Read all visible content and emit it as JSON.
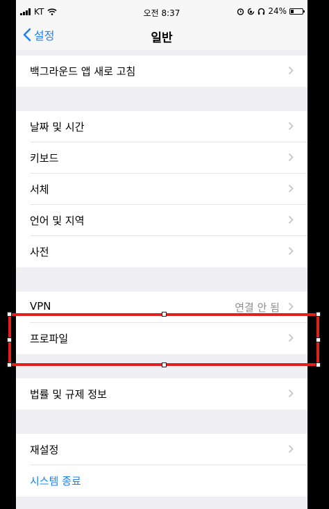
{
  "status_bar": {
    "carrier": "KT",
    "time": "오전 8:37",
    "battery": "24%",
    "battery_level": 0.24
  },
  "nav": {
    "back_label": "설정",
    "title": "일반"
  },
  "groups": [
    {
      "items": [
        {
          "label": "백그라운드 앱 새로 고침"
        }
      ]
    },
    {
      "items": [
        {
          "label": "날짜 및 시간"
        },
        {
          "label": "키보드"
        },
        {
          "label": "서체"
        },
        {
          "label": "언어 및 지역"
        },
        {
          "label": "사전"
        }
      ]
    },
    {
      "items": [
        {
          "label": "VPN",
          "value": "연결 안 됨"
        },
        {
          "label": "프로파일"
        }
      ]
    },
    {
      "items": [
        {
          "label": "법률 및 규제 정보"
        }
      ]
    },
    {
      "items": [
        {
          "label": "재설정"
        },
        {
          "label": "시스템 종료"
        }
      ]
    }
  ],
  "colors": {
    "accent": "#1a82fb",
    "selection": "#e0201c",
    "background": "#efeff4"
  }
}
